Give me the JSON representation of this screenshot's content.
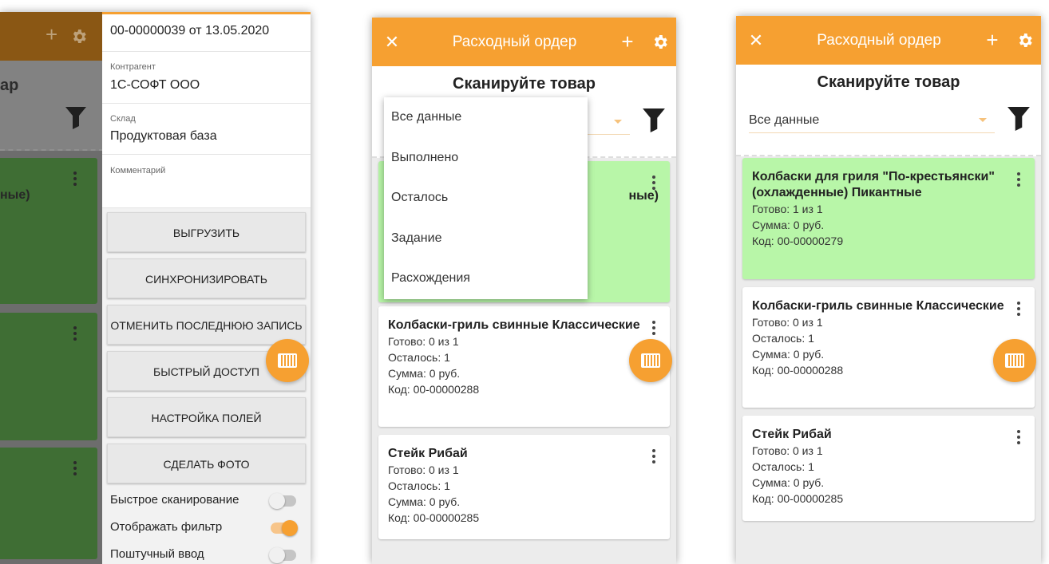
{
  "left_screen": {
    "background_title": "ар",
    "background_card_text": "ные)",
    "drawer": {
      "doc_header": "00-00000039 от 13.05.2020",
      "counterparty_label": "Контрагент",
      "counterparty_value": "1С-СОФТ ООО",
      "warehouse_label": "Склад",
      "warehouse_value": "Продуктовая база",
      "comment_label": "Комментарий",
      "comment_value": "",
      "buttons": [
        "ВЫГРУЗИТЬ",
        "СИНХРОНИЗИРОВАТЬ",
        "ОТМЕНИТЬ ПОСЛЕДНЮЮ ЗАПИСЬ",
        "БЫСТРЫЙ ДОСТУП",
        "НАСТРОЙКА ПОЛЕЙ",
        "СДЕЛАТЬ ФОТО"
      ],
      "toggles": [
        {
          "label": "Быстрое сканирование",
          "on": false
        },
        {
          "label": "Отображать фильтр",
          "on": true
        },
        {
          "label": "Поштучный ввод",
          "on": false
        }
      ]
    }
  },
  "middle_screen": {
    "appbar_title": "Расходный ордер",
    "scan_title": "Сканируйте товар",
    "dropdown_options": [
      "Все данные",
      "Выполнено",
      "Осталось",
      "Задание",
      "Расхождения"
    ],
    "partial_card_text": "ные)",
    "cards": [
      {
        "name": "Колбаски-гриль свинные Классические",
        "ready": "Готово: 0 из 1",
        "left": "Осталось: 1",
        "sum": "Сумма: 0 руб.",
        "code": "Код: 00-00000288"
      },
      {
        "name": "Стейк Рибай",
        "ready": "Готово: 0 из 1",
        "left": "Осталось: 1",
        "sum": "Сумма: 0 руб.",
        "code": "Код: 00-00000285"
      }
    ]
  },
  "right_screen": {
    "appbar_title": "Расходный ордер",
    "scan_title": "Сканируйте товар",
    "filter_value": "Все данные",
    "cards": [
      {
        "name": "Колбаски для гриля \"По-крестьянски\" (охлажденные) Пикантные",
        "ready": "Готово: 1 из 1",
        "left": "",
        "sum": "Сумма: 0 руб.",
        "code": "Код: 00-00000279"
      },
      {
        "name": "Колбаски-гриль свинные Классические",
        "ready": "Готово: 0 из 1",
        "left": "Осталось: 1",
        "sum": "Сумма: 0 руб.",
        "code": "Код: 00-00000288"
      },
      {
        "name": "Стейк Рибай",
        "ready": "Готово: 0 из 1",
        "left": "Осталось: 1",
        "sum": "Сумма: 0 руб.",
        "code": "Код: 00-00000285"
      }
    ]
  },
  "icons": {
    "close": "close-icon",
    "add": "plus-icon",
    "settings": "gear-icon",
    "filter": "funnel-icon",
    "scan": "barcode-icon",
    "more": "more-vert-icon"
  },
  "colors": {
    "accent": "#f6a031",
    "done_card": "#b8f6a8"
  }
}
